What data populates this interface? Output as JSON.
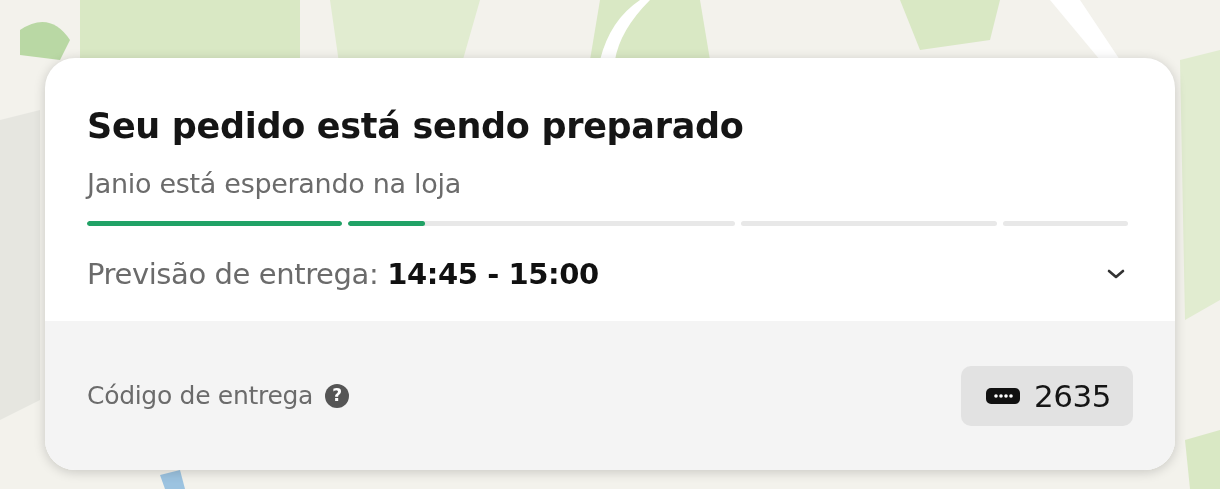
{
  "order_card": {
    "title": "Seu pedido está sendo preparado",
    "subtitle": "Janio está esperando na loja",
    "progress": [
      {
        "level": 1
      },
      {
        "level": 0.2
      },
      {
        "level": 0
      },
      {
        "level": 0
      }
    ],
    "estimate": {
      "text": "Previsão de entrega: **14:45 - 15:00**",
      "expanded": false
    },
    "delivery_code": {
      "label": "Código de entrega",
      "help": "?",
      "code": "2635"
    }
  }
}
